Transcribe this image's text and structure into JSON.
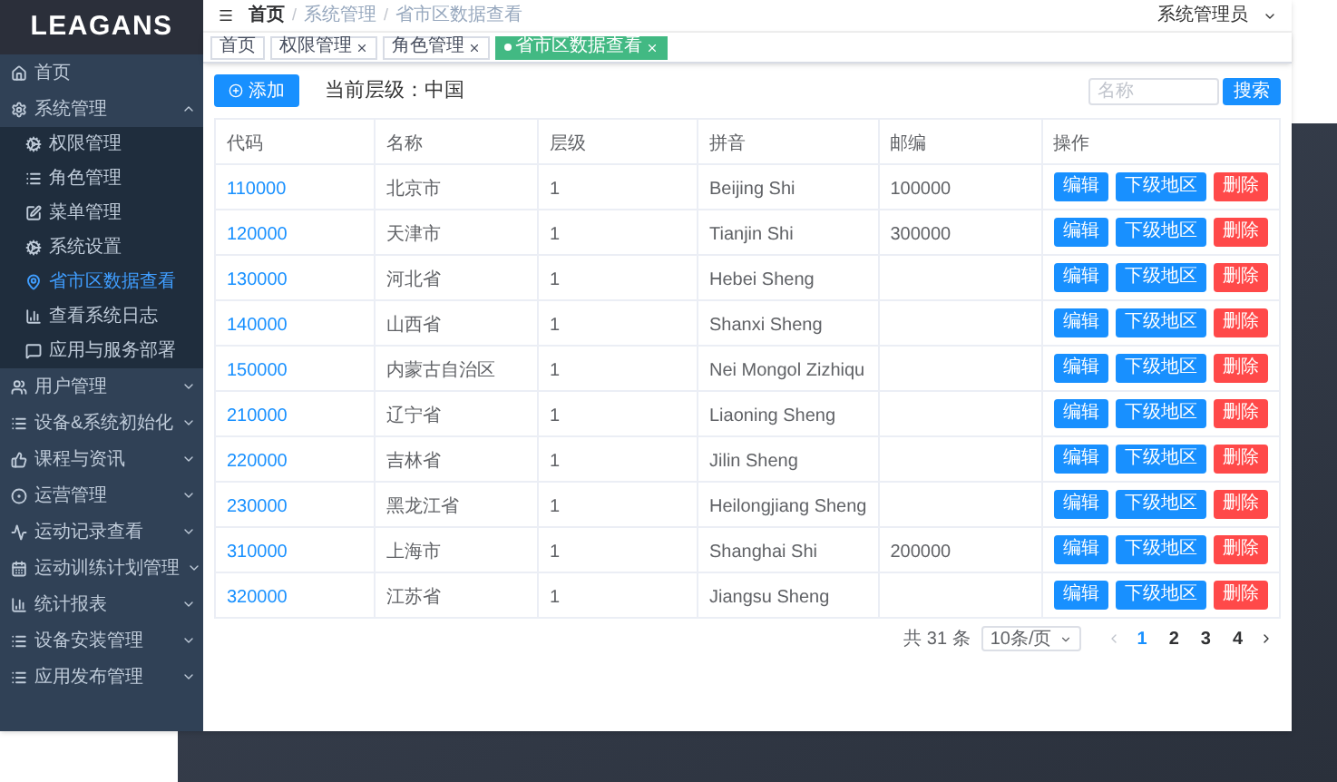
{
  "logo": "LEAGANS",
  "sidebar": {
    "items": [
      {
        "label": "首页",
        "kind": "link",
        "selected": false
      },
      {
        "label": "系统管理",
        "kind": "group",
        "expanded": true,
        "selected": false,
        "children": [
          {
            "label": "权限管理",
            "selected": false
          },
          {
            "label": "角色管理",
            "selected": false
          },
          {
            "label": "菜单管理",
            "selected": false
          },
          {
            "label": "系统设置",
            "selected": false
          },
          {
            "label": "省市区数据查看",
            "selected": true
          },
          {
            "label": "查看系统日志",
            "selected": false
          },
          {
            "label": "应用与服务部署",
            "selected": false
          }
        ]
      },
      {
        "label": "用户管理",
        "kind": "group",
        "expanded": false,
        "selected": false
      },
      {
        "label": "设备&系统初始化",
        "kind": "group",
        "expanded": false,
        "selected": false
      },
      {
        "label": "课程与资讯",
        "kind": "group",
        "expanded": false,
        "selected": false
      },
      {
        "label": "运营管理",
        "kind": "group",
        "expanded": false,
        "selected": false
      },
      {
        "label": "运动记录查看",
        "kind": "group",
        "expanded": false,
        "selected": false
      },
      {
        "label": "运动训练计划管理",
        "kind": "group",
        "expanded": false,
        "selected": false
      },
      {
        "label": "统计报表",
        "kind": "group",
        "expanded": false,
        "selected": false
      },
      {
        "label": "设备安装管理",
        "kind": "group",
        "expanded": false,
        "selected": false
      },
      {
        "label": "应用发布管理",
        "kind": "group",
        "expanded": false,
        "selected": false
      }
    ]
  },
  "breadcrumb": {
    "items": [
      "首页",
      "系统管理",
      "省市区数据查看"
    ],
    "separator": "/"
  },
  "user": "系统管理员",
  "tabs": [
    {
      "label": "首页",
      "closable": false,
      "selected": false
    },
    {
      "label": "权限管理",
      "closable": true,
      "selected": false
    },
    {
      "label": "角色管理",
      "closable": true,
      "selected": false
    },
    {
      "label": "省市区数据查看",
      "closable": true,
      "selected": true
    }
  ],
  "toolbar": {
    "add_button": "添加",
    "level_label": "当前层级：",
    "level_value": "中国",
    "search": {
      "placeholder": "名称"
    },
    "search_button": "搜索"
  },
  "table": {
    "columns": [
      "代码",
      "名称",
      "层级",
      "拼音",
      "邮编",
      "操作"
    ],
    "rows": [
      {
        "cells": [
          "110000",
          "北京市",
          "1",
          "Beijing Shi",
          "100000"
        ],
        "actions": [
          "编辑",
          "下级地区",
          "删除"
        ]
      },
      {
        "cells": [
          "120000",
          "天津市",
          "1",
          "Tianjin Shi",
          "300000"
        ],
        "actions": [
          "编辑",
          "下级地区",
          "删除"
        ]
      },
      {
        "cells": [
          "130000",
          "河北省",
          "1",
          "Hebei Sheng",
          ""
        ],
        "actions": [
          "编辑",
          "下级地区",
          "删除"
        ]
      },
      {
        "cells": [
          "140000",
          "山西省",
          "1",
          "Shanxi Sheng",
          ""
        ],
        "actions": [
          "编辑",
          "下级地区",
          "删除"
        ]
      },
      {
        "cells": [
          "150000",
          "内蒙古自治区",
          "1",
          "Nei Mongol Zizhiqu",
          ""
        ],
        "actions": [
          "编辑",
          "下级地区",
          "删除"
        ]
      },
      {
        "cells": [
          "210000",
          "辽宁省",
          "1",
          "Liaoning Sheng",
          ""
        ],
        "actions": [
          "编辑",
          "下级地区",
          "删除"
        ]
      },
      {
        "cells": [
          "220000",
          "吉林省",
          "1",
          "Jilin Sheng",
          ""
        ],
        "actions": [
          "编辑",
          "下级地区",
          "删除"
        ]
      },
      {
        "cells": [
          "230000",
          "黑龙江省",
          "1",
          "Heilongjiang Sheng",
          ""
        ],
        "actions": [
          "编辑",
          "下级地区",
          "删除"
        ]
      },
      {
        "cells": [
          "310000",
          "上海市",
          "1",
          "Shanghai Shi",
          "200000"
        ],
        "actions": [
          "编辑",
          "下级地区",
          "删除"
        ]
      },
      {
        "cells": [
          "320000",
          "江苏省",
          "1",
          "Jiangsu Sheng",
          ""
        ],
        "actions": [
          "编辑",
          "下级地区",
          "删除"
        ]
      }
    ]
  },
  "pagination": {
    "total": "共 31 条",
    "page_size": "10条/页",
    "pages": [
      {
        "label": "1",
        "selected": true
      },
      {
        "label": "2",
        "selected": false
      },
      {
        "label": "3",
        "selected": false
      },
      {
        "label": "4",
        "selected": false
      }
    ]
  }
}
